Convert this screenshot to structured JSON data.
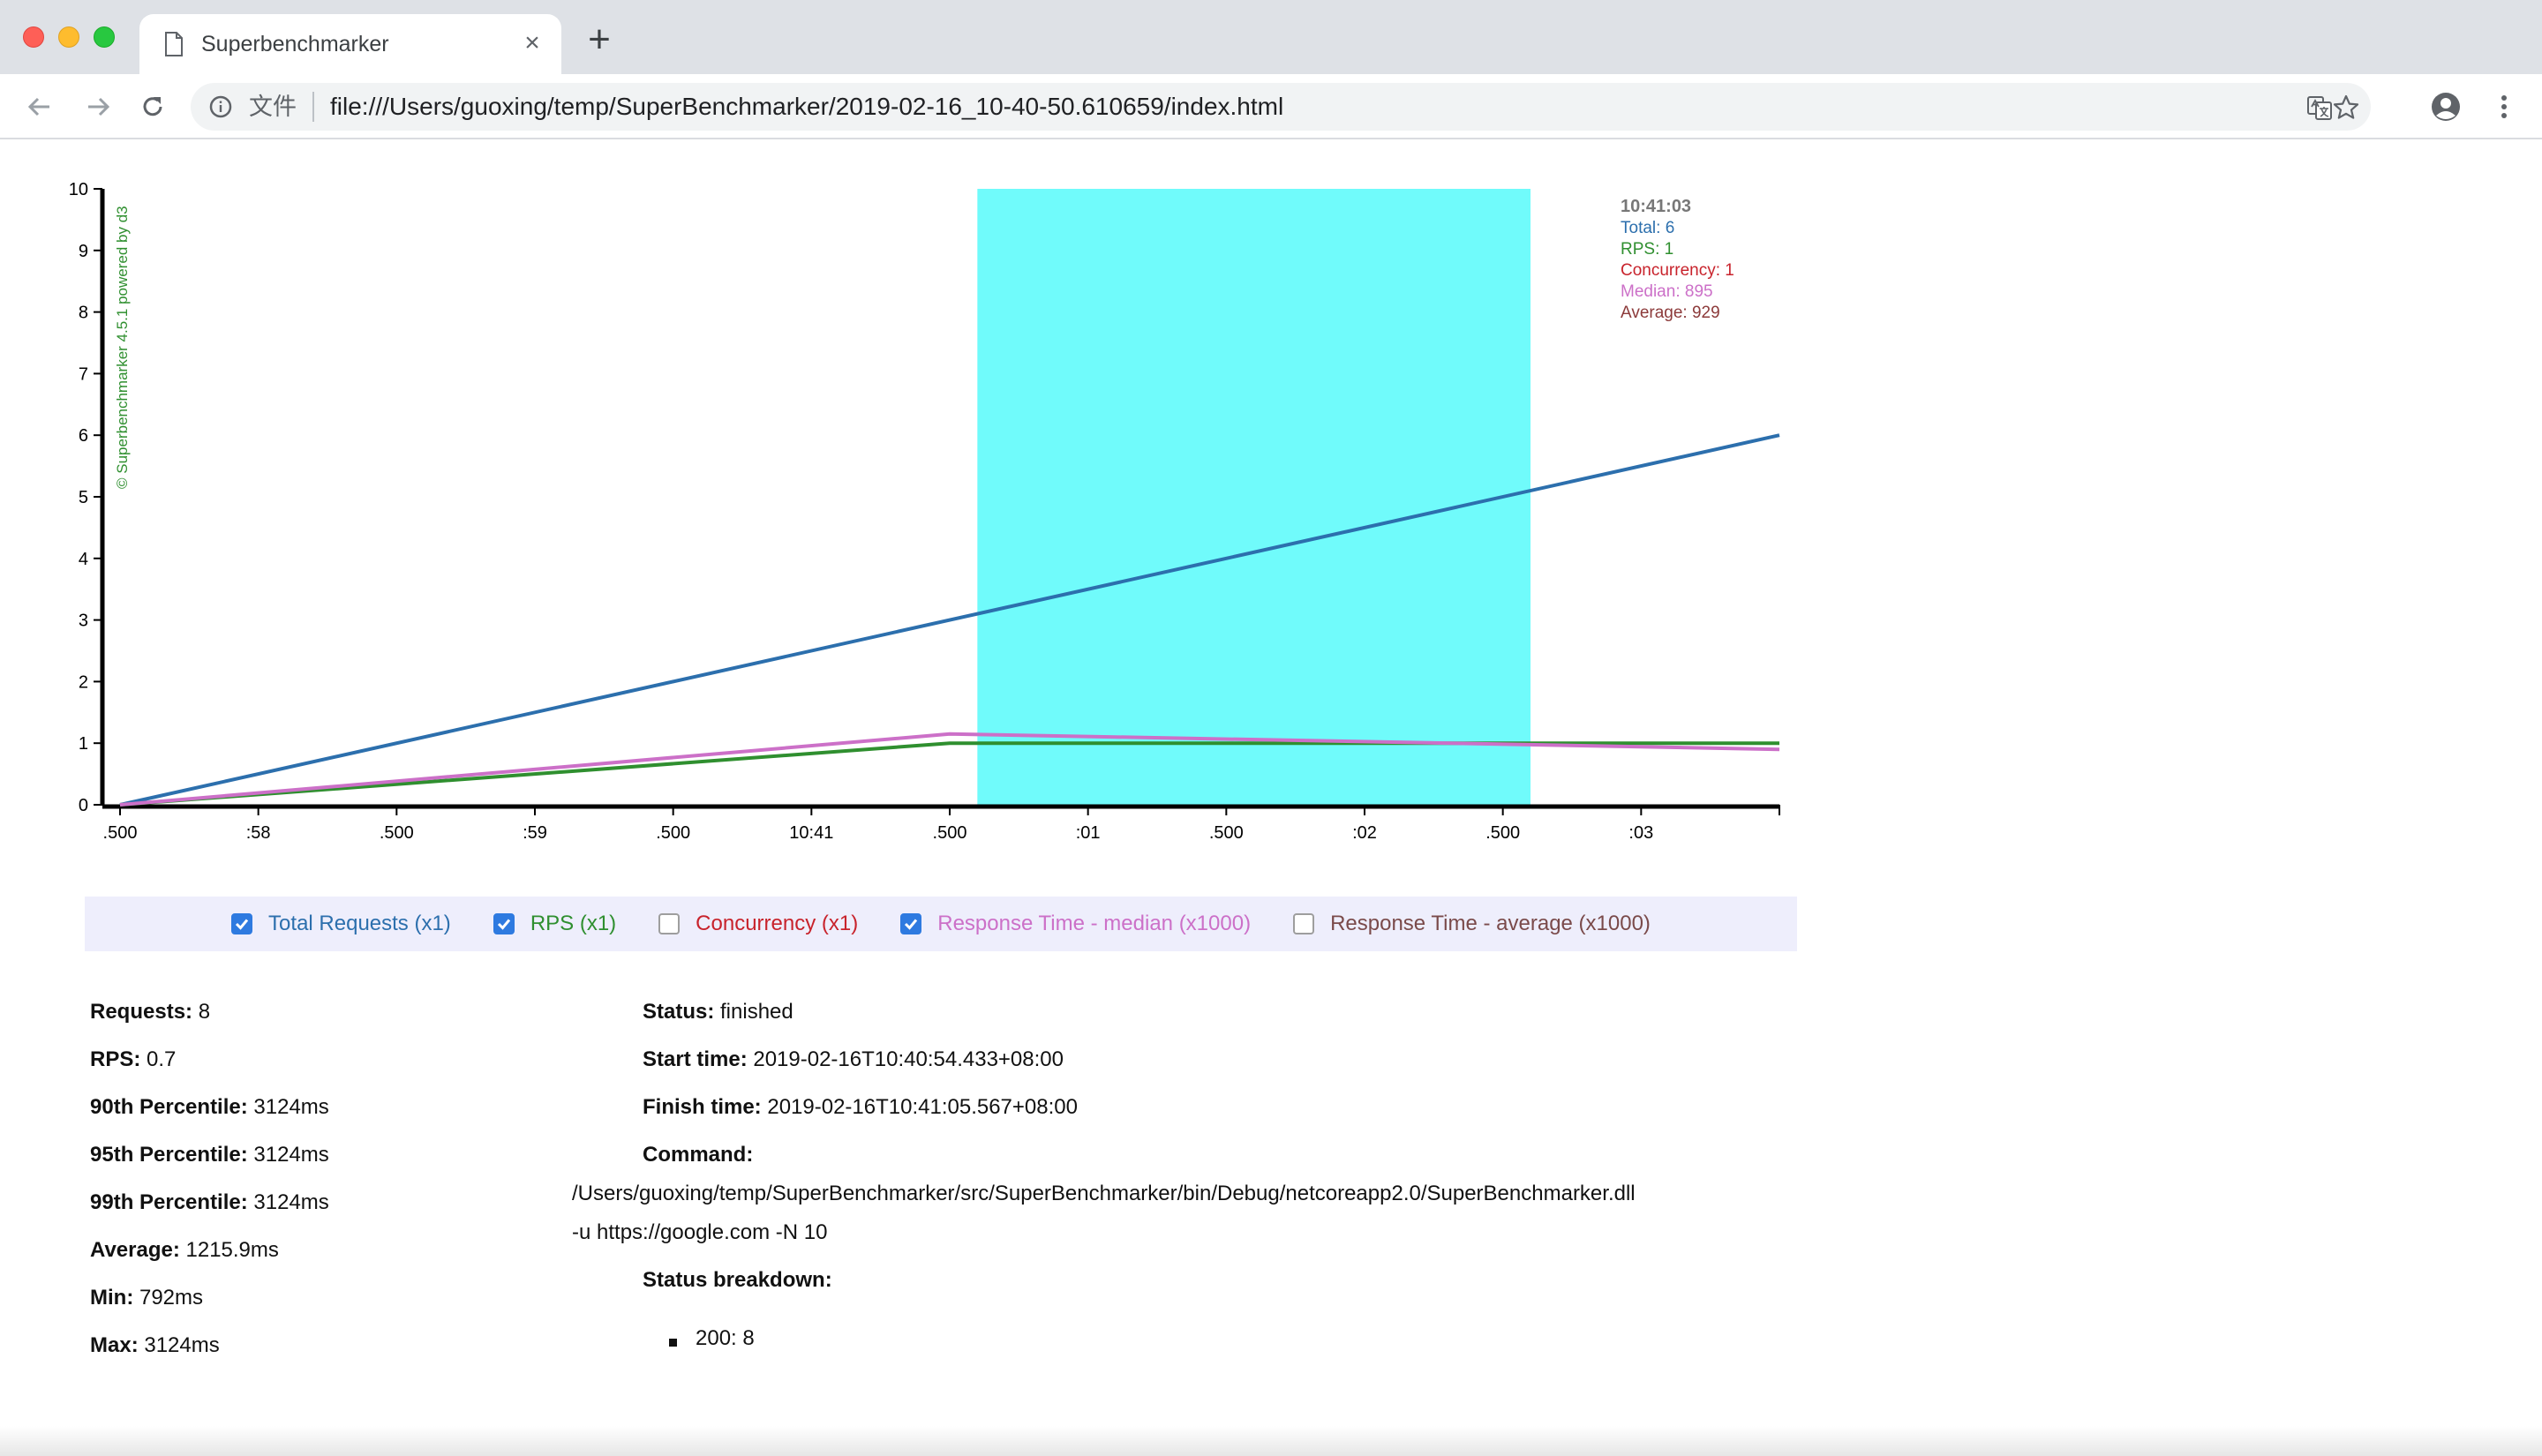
{
  "browser": {
    "tab_title": "Superbenchmarker",
    "url_scheme_label": "文件",
    "url": "file:///Users/guoxing/temp/SuperBenchmarker/2019-02-16_10-40-50.610659/index.html"
  },
  "chart_data": {
    "type": "line",
    "y_ticks": [
      "0",
      "1",
      "2",
      "3",
      "4",
      "5",
      "6",
      "7",
      "8",
      "9",
      "10"
    ],
    "ylim": [
      0,
      10
    ],
    "x_ticks": [
      ".500",
      ":58",
      ".500",
      ":59",
      ".500",
      "10:41",
      ".500",
      ":01",
      ".500",
      ":02",
      ".500",
      ":03"
    ],
    "watermark": "© Superbenchmarker 4.5.1 powered by d3",
    "highlight_band": {
      "from_tick_index": 6.2,
      "to_tick_index": 10.2,
      "color": "#70fbfb"
    },
    "series": [
      {
        "name": "Total",
        "color": "#2c6fad",
        "points": [
          [
            0,
            0
          ],
          [
            12,
            6
          ]
        ]
      },
      {
        "name": "RPS",
        "color": "#2f8f2f",
        "points": [
          [
            0,
            0
          ],
          [
            6,
            1
          ],
          [
            12,
            1
          ]
        ]
      },
      {
        "name": "Median",
        "color": "#cc70c8",
        "points": [
          [
            0,
            0
          ],
          [
            6,
            1.15
          ],
          [
            12,
            0.9
          ]
        ]
      }
    ],
    "tooltip": {
      "time": "10:41:03",
      "lines": [
        {
          "text": "Total: 6",
          "color": "#2c6fad"
        },
        {
          "text": "RPS: 1",
          "color": "#2f8f2f"
        },
        {
          "text": "Concurrency: 1",
          "color": "#c8232c"
        },
        {
          "text": "Median: 895",
          "color": "#cc70c8"
        },
        {
          "text": "Average: 929",
          "color": "#8c3a3a"
        }
      ]
    }
  },
  "legend": [
    {
      "label": "Total Requests (x1)",
      "checked": true,
      "color": "#2c6fad"
    },
    {
      "label": "RPS (x1)",
      "checked": true,
      "color": "#2f8f2f"
    },
    {
      "label": "Concurrency (x1)",
      "checked": false,
      "color": "#c8232c"
    },
    {
      "label": "Response Time - median (x1000)",
      "checked": true,
      "color": "#cc70c8"
    },
    {
      "label": "Response Time - average (x1000)",
      "checked": false,
      "color": "#7a4a4a"
    }
  ],
  "stats_left": [
    {
      "label": "Requests:",
      "value": " 8"
    },
    {
      "label": "RPS:",
      "value": " 0.7"
    },
    {
      "label": "90th Percentile:",
      "value": " 3124ms"
    },
    {
      "label": "95th Percentile:",
      "value": " 3124ms"
    },
    {
      "label": "99th Percentile:",
      "value": " 3124ms"
    },
    {
      "label": "Average:",
      "value": " 1215.9ms"
    },
    {
      "label": "Min:",
      "value": " 792ms"
    },
    {
      "label": "Max:",
      "value": " 3124ms"
    }
  ],
  "stats_right": {
    "status_label": "Status:",
    "status_value": " finished",
    "start_label": "Start time:",
    "start_value": " 2019-02-16T10:40:54.433+08:00",
    "finish_label": "Finish time:",
    "finish_value": " 2019-02-16T10:41:05.567+08:00",
    "command_label": "Command:",
    "command_line1": "/Users/guoxing/temp/SuperBenchmarker/src/SuperBenchmarker/bin/Debug/netcoreapp2.0/SuperBenchmarker.dll",
    "command_line2": "-u https://google.com -N 10",
    "breakdown_label": "Status breakdown:",
    "breakdown_items": [
      "200: 8"
    ]
  }
}
